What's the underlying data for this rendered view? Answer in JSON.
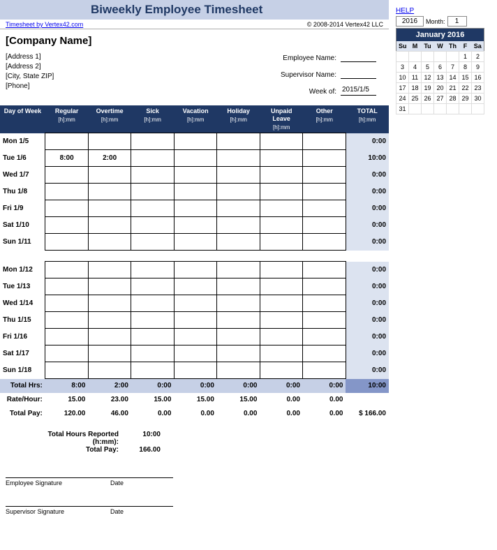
{
  "title": "Biweekly Employee Timesheet",
  "attribution": "Timesheet by Vertex42.com",
  "copyright": "© 2008-2014 Vertex42 LLC",
  "company": {
    "name": "[Company Name]",
    "address1": "[Address 1]",
    "address2": "[Address 2]",
    "citystatezip": "[City, State  ZIP]",
    "phone": "[Phone]"
  },
  "fields": {
    "employee_label": "Employee Name:",
    "employee_value": "",
    "supervisor_label": "Supervisor Name:",
    "supervisor_value": "",
    "weekof_label": "Week of:",
    "weekof_value": "2015/1/5"
  },
  "headers": {
    "day": "Day of Week",
    "cols": [
      "Regular",
      "Overtime",
      "Sick",
      "Vacation",
      "Holiday",
      "Unpaid Leave",
      "Other"
    ],
    "sub": "[h]:mm",
    "total": "TOTAL"
  },
  "week1": [
    {
      "day": "Mon 1/5",
      "v": [
        "",
        "",
        "",
        "",
        "",
        "",
        ""
      ],
      "t": "0:00"
    },
    {
      "day": "Tue 1/6",
      "v": [
        "8:00",
        "2:00",
        "",
        "",
        "",
        "",
        ""
      ],
      "t": "10:00"
    },
    {
      "day": "Wed 1/7",
      "v": [
        "",
        "",
        "",
        "",
        "",
        "",
        ""
      ],
      "t": "0:00"
    },
    {
      "day": "Thu 1/8",
      "v": [
        "",
        "",
        "",
        "",
        "",
        "",
        ""
      ],
      "t": "0:00"
    },
    {
      "day": "Fri 1/9",
      "v": [
        "",
        "",
        "",
        "",
        "",
        "",
        ""
      ],
      "t": "0:00"
    },
    {
      "day": "Sat 1/10",
      "v": [
        "",
        "",
        "",
        "",
        "",
        "",
        ""
      ],
      "t": "0:00"
    },
    {
      "day": "Sun 1/11",
      "v": [
        "",
        "",
        "",
        "",
        "",
        "",
        ""
      ],
      "t": "0:00"
    }
  ],
  "week2": [
    {
      "day": "Mon 1/12",
      "v": [
        "",
        "",
        "",
        "",
        "",
        "",
        ""
      ],
      "t": "0:00"
    },
    {
      "day": "Tue 1/13",
      "v": [
        "",
        "",
        "",
        "",
        "",
        "",
        ""
      ],
      "t": "0:00"
    },
    {
      "day": "Wed 1/14",
      "v": [
        "",
        "",
        "",
        "",
        "",
        "",
        ""
      ],
      "t": "0:00"
    },
    {
      "day": "Thu 1/15",
      "v": [
        "",
        "",
        "",
        "",
        "",
        "",
        ""
      ],
      "t": "0:00"
    },
    {
      "day": "Fri 1/16",
      "v": [
        "",
        "",
        "",
        "",
        "",
        "",
        ""
      ],
      "t": "0:00"
    },
    {
      "day": "Sat 1/17",
      "v": [
        "",
        "",
        "",
        "",
        "",
        "",
        ""
      ],
      "t": "0:00"
    },
    {
      "day": "Sun 1/18",
      "v": [
        "",
        "",
        "",
        "",
        "",
        "",
        ""
      ],
      "t": "0:00"
    }
  ],
  "totals": {
    "label_hrs": "Total Hrs:",
    "hrs": [
      "8:00",
      "2:00",
      "0:00",
      "0:00",
      "0:00",
      "0:00",
      "0:00"
    ],
    "hrs_total": "10:00",
    "label_rate": "Rate/Hour:",
    "rate": [
      "15.00",
      "23.00",
      "15.00",
      "15.00",
      "15.00",
      "0.00",
      "0.00"
    ],
    "label_pay": "Total Pay:",
    "pay": [
      "120.00",
      "46.00",
      "0.00",
      "0.00",
      "0.00",
      "0.00",
      "0.00"
    ],
    "pay_total": "$   166.00"
  },
  "summary": {
    "hrs_label": "Total Hours Reported (h:mm):",
    "hrs_value": "10:00",
    "pay_label": "Total Pay:",
    "pay_value": "166.00"
  },
  "sig": {
    "emp": "Employee Signature",
    "sup": "Supervisor Signature",
    "date": "Date"
  },
  "help": "HELP",
  "cal": {
    "year": "2016",
    "month_label": "Month:",
    "month": "1",
    "title": "January 2016",
    "dow": [
      "Su",
      "M",
      "Tu",
      "W",
      "Th",
      "F",
      "Sa"
    ],
    "grid": [
      [
        "",
        "",
        "",
        "",
        "",
        "1",
        "2"
      ],
      [
        "3",
        "4",
        "5",
        "6",
        "7",
        "8",
        "9"
      ],
      [
        "10",
        "11",
        "12",
        "13",
        "14",
        "15",
        "16"
      ],
      [
        "17",
        "18",
        "19",
        "20",
        "21",
        "22",
        "23"
      ],
      [
        "24",
        "25",
        "26",
        "27",
        "28",
        "29",
        "30"
      ],
      [
        "31",
        "",
        "",
        "",
        "",
        "",
        ""
      ]
    ]
  }
}
